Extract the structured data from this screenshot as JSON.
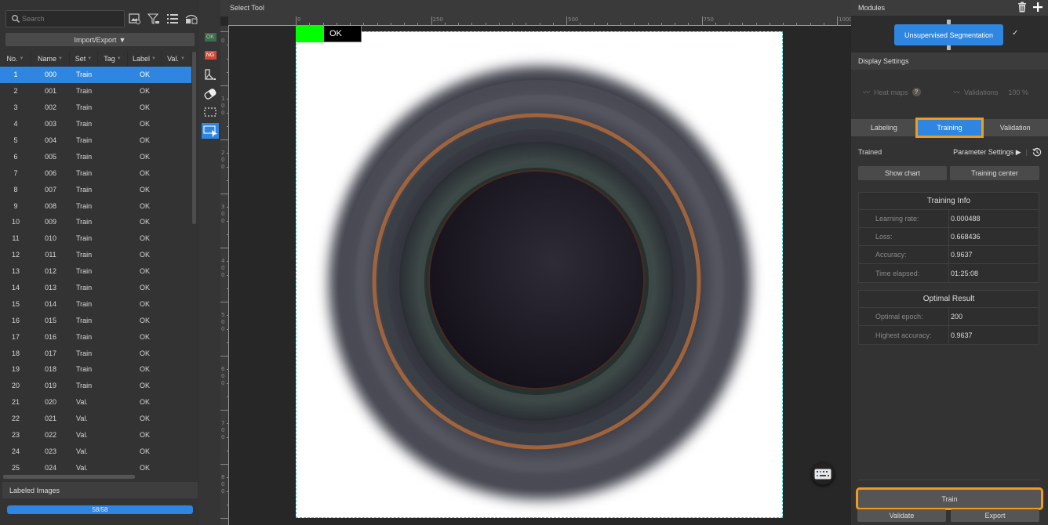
{
  "left_panel": {
    "search": {
      "placeholder": "Search",
      "value": ""
    },
    "toolbar_icons": [
      "image-settings-icon",
      "filter-icon",
      "list-icon",
      "layout-icon"
    ],
    "import_export_label": "Import/Export",
    "columns": [
      "No.",
      "Name",
      "Set",
      "Tag",
      "Label",
      "Val."
    ],
    "rows": [
      {
        "no": "1",
        "name": "000",
        "set": "Train",
        "tag": "",
        "label": "OK",
        "val": ""
      },
      {
        "no": "2",
        "name": "001",
        "set": "Train",
        "tag": "",
        "label": "OK",
        "val": ""
      },
      {
        "no": "3",
        "name": "002",
        "set": "Train",
        "tag": "",
        "label": "OK",
        "val": ""
      },
      {
        "no": "4",
        "name": "003",
        "set": "Train",
        "tag": "",
        "label": "OK",
        "val": ""
      },
      {
        "no": "5",
        "name": "004",
        "set": "Train",
        "tag": "",
        "label": "OK",
        "val": ""
      },
      {
        "no": "6",
        "name": "005",
        "set": "Train",
        "tag": "",
        "label": "OK",
        "val": ""
      },
      {
        "no": "7",
        "name": "006",
        "set": "Train",
        "tag": "",
        "label": "OK",
        "val": ""
      },
      {
        "no": "8",
        "name": "007",
        "set": "Train",
        "tag": "",
        "label": "OK",
        "val": ""
      },
      {
        "no": "9",
        "name": "008",
        "set": "Train",
        "tag": "",
        "label": "OK",
        "val": ""
      },
      {
        "no": "10",
        "name": "009",
        "set": "Train",
        "tag": "",
        "label": "OK",
        "val": ""
      },
      {
        "no": "11",
        "name": "010",
        "set": "Train",
        "tag": "",
        "label": "OK",
        "val": ""
      },
      {
        "no": "12",
        "name": "011",
        "set": "Train",
        "tag": "",
        "label": "OK",
        "val": ""
      },
      {
        "no": "13",
        "name": "012",
        "set": "Train",
        "tag": "",
        "label": "OK",
        "val": ""
      },
      {
        "no": "14",
        "name": "013",
        "set": "Train",
        "tag": "",
        "label": "OK",
        "val": ""
      },
      {
        "no": "15",
        "name": "014",
        "set": "Train",
        "tag": "",
        "label": "OK",
        "val": ""
      },
      {
        "no": "16",
        "name": "015",
        "set": "Train",
        "tag": "",
        "label": "OK",
        "val": ""
      },
      {
        "no": "17",
        "name": "016",
        "set": "Train",
        "tag": "",
        "label": "OK",
        "val": ""
      },
      {
        "no": "18",
        "name": "017",
        "set": "Train",
        "tag": "",
        "label": "OK",
        "val": ""
      },
      {
        "no": "19",
        "name": "018",
        "set": "Train",
        "tag": "",
        "label": "OK",
        "val": ""
      },
      {
        "no": "20",
        "name": "019",
        "set": "Train",
        "tag": "",
        "label": "OK",
        "val": ""
      },
      {
        "no": "21",
        "name": "020",
        "set": "Val.",
        "tag": "",
        "label": "OK",
        "val": ""
      },
      {
        "no": "22",
        "name": "021",
        "set": "Val.",
        "tag": "",
        "label": "OK",
        "val": ""
      },
      {
        "no": "23",
        "name": "022",
        "set": "Val.",
        "tag": "",
        "label": "OK",
        "val": ""
      },
      {
        "no": "24",
        "name": "023",
        "set": "Val.",
        "tag": "",
        "label": "OK",
        "val": ""
      },
      {
        "no": "25",
        "name": "024",
        "set": "Val.",
        "tag": "",
        "label": "OK",
        "val": ""
      }
    ],
    "selected_row": 0,
    "labeled_images_title": "Labeled Images",
    "labeled_progress": {
      "text": "58/58",
      "fraction": 1.0
    }
  },
  "tools": {
    "ok_tag": "OK",
    "ng_tag": "NG",
    "items": [
      "polygon-tool-icon",
      "eraser-icon",
      "rect-select-icon",
      "select-tool-icon"
    ],
    "active": "select-tool-icon"
  },
  "canvas": {
    "title": "Select Tool",
    "h_ruler_labels": [
      "0",
      "250",
      "500",
      "750",
      "1000"
    ],
    "v_ruler_labels": [
      "0",
      "100",
      "200",
      "300",
      "400",
      "500",
      "600",
      "700",
      "800"
    ],
    "image_label": "OK",
    "image_label_color": "#00ff00"
  },
  "right_panel": {
    "modules_title": "Modules",
    "module_name": "Unsupervised Segmentation",
    "display_settings_title": "Display Settings",
    "heat_maps_label": "Heat maps",
    "validations_label": "Validations",
    "validations_value": "100 %",
    "tabs": [
      "Labeling",
      "Training",
      "Validation"
    ],
    "active_tab": "Training",
    "status": "Trained",
    "parameter_settings_label": "Parameter Settings",
    "show_chart_label": "Show chart",
    "training_center_label": "Training center",
    "training_info": {
      "title": "Training Info",
      "rows": [
        {
          "key": "Learning rate:",
          "value": "0.000488"
        },
        {
          "key": "Loss:",
          "value": "0.668436"
        },
        {
          "key": "Accuracy:",
          "value": "0.9637"
        },
        {
          "key": "Time elapsed:",
          "value": "01:25:08"
        }
      ]
    },
    "optimal_result": {
      "title": "Optimal Result",
      "rows": [
        {
          "key": "Optimal epoch:",
          "value": "200"
        },
        {
          "key": "Highest accuracy:",
          "value": "0.9637"
        }
      ]
    },
    "train_label": "Train",
    "validate_label": "Validate",
    "export_label": "Export",
    "accent_color": "#2f86e0",
    "highlight_color": "#f29a1d"
  }
}
